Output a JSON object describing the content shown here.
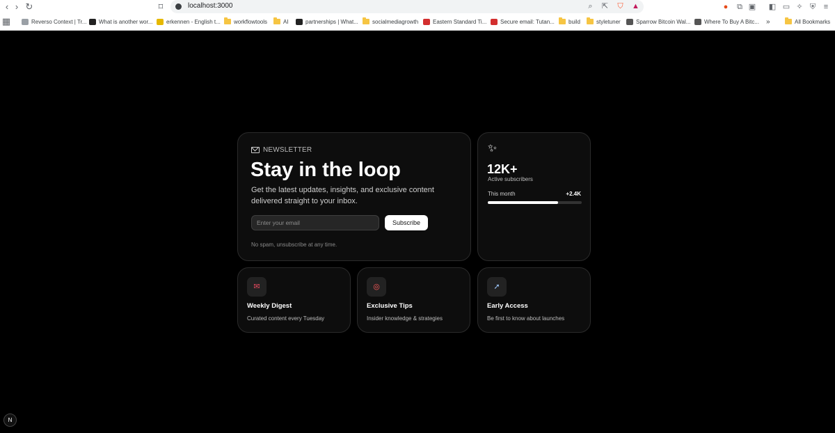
{
  "browser": {
    "url": "localhost:3000",
    "bookmarks": [
      {
        "label": "Reverso Context | Tr...",
        "icon": "reverso-icon",
        "color": "#9aa0a6"
      },
      {
        "label": "What is another wor...",
        "icon": "h-icon",
        "color": "#222222"
      },
      {
        "label": "erkennen - English t...",
        "icon": "dict-icon",
        "color": "#e6b800"
      },
      {
        "label": "workflowtools",
        "icon": "folder-icon",
        "color": "#f6c543"
      },
      {
        "label": "AI",
        "icon": "folder-icon",
        "color": "#f6c543"
      },
      {
        "label": "partnerships | What...",
        "icon": "n-icon",
        "color": "#222222"
      },
      {
        "label": "socialmediagrowth",
        "icon": "folder-icon",
        "color": "#f6c543"
      },
      {
        "label": "Eastern Standard Ti...",
        "icon": "clock-icon",
        "color": "#d32f2f"
      },
      {
        "label": "Secure email: Tutan...",
        "icon": "tutanota-icon",
        "color": "#d32f2f"
      },
      {
        "label": "build",
        "icon": "folder-icon",
        "color": "#f6c543"
      },
      {
        "label": "styletuner",
        "icon": "folder-icon",
        "color": "#f6c543"
      },
      {
        "label": "Sparrow Bitcoin Wal...",
        "icon": "sparrow-icon",
        "color": "#555555"
      },
      {
        "label": "Where To Buy A Bitc...",
        "icon": "bitcoin-icon",
        "color": "#555555"
      }
    ],
    "all_bookmarks": "All Bookmarks",
    "overflow": "»"
  },
  "newsletter": {
    "eyebrow": "NEWSLETTER",
    "title": "Stay in the loop",
    "description": "Get the latest updates, insights, and exclusive content delivered straight to your inbox.",
    "email_placeholder": "Enter your email",
    "subscribe_label": "Subscribe",
    "fineprint": "No spam, unsubscribe at any time."
  },
  "stats": {
    "count": "12K+",
    "count_label": "Active subscribers",
    "month_label": "This month",
    "month_value": "+2.4K",
    "progress_percent": 75
  },
  "features": [
    {
      "title": "Weekly Digest",
      "description": "Curated content every Tuesday",
      "icon": "envelope-icon",
      "glyph": "✉",
      "color": "#e84a5f"
    },
    {
      "title": "Exclusive Tips",
      "description": "Insider knowledge & strategies",
      "icon": "target-icon",
      "glyph": "◎",
      "color": "#ff5a5a"
    },
    {
      "title": "Early Access",
      "description": "Be first to know about launches",
      "icon": "rocket-icon",
      "glyph": "➚",
      "color": "#9ec9ff"
    }
  ],
  "nextjs_badge": "N"
}
